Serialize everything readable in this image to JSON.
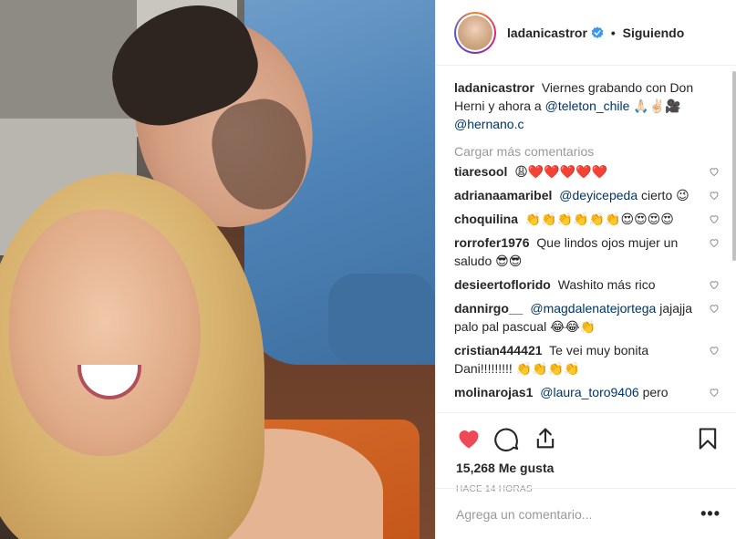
{
  "header": {
    "username": "ladanicastror",
    "verified_icon": "verified-badge-icon",
    "separator": "•",
    "follow_label": "Siguiendo"
  },
  "caption": {
    "username": "ladanicastror",
    "text": "Viernes grabando con Don Herni y ahora a",
    "mention_1": "@teleton_chile",
    "emojis": "🙏🏻✌🏻🎥",
    "mention_2": "@hernano.c"
  },
  "load_more_label": "Cargar más comentarios",
  "comments": [
    {
      "username": "tiaresool",
      "text": "😩❤️❤️❤️❤️❤️",
      "mention": ""
    },
    {
      "username": "adrianaamaribel",
      "text": "cierto 😉",
      "mention": "@deyicepeda"
    },
    {
      "username": "choquilina",
      "text": "👏👏👏👏👏👏😍😍😍😍",
      "mention": ""
    },
    {
      "username": "rorrofer1976",
      "text": "Que lindos ojos mujer un saludo 😎😎",
      "mention": ""
    },
    {
      "username": "desieertoflorido",
      "text": "Washito más rico",
      "mention": ""
    },
    {
      "username": "dannirgo__",
      "text": "jajajja palo pal pascual 😂😂👏",
      "mention": "@magdalenatejortega"
    },
    {
      "username": "cristian444421",
      "text": "Te vei muy bonita Dani!!!!!!!!! 👏👏👏👏",
      "mention": ""
    },
    {
      "username": "molinarojas1",
      "text": "pero",
      "mention": "@laura_toro9406"
    }
  ],
  "actions": {
    "like_icon": "heart-filled-icon",
    "comment_icon": "comment-icon",
    "share_icon": "share-icon",
    "save_icon": "bookmark-icon",
    "like_color": "#ed4956"
  },
  "likes_text": "15,268 Me gusta",
  "time_text": "HACE 14 HORAS",
  "add_comment": {
    "placeholder": "Agrega un comentario...",
    "more_label": "•••"
  }
}
